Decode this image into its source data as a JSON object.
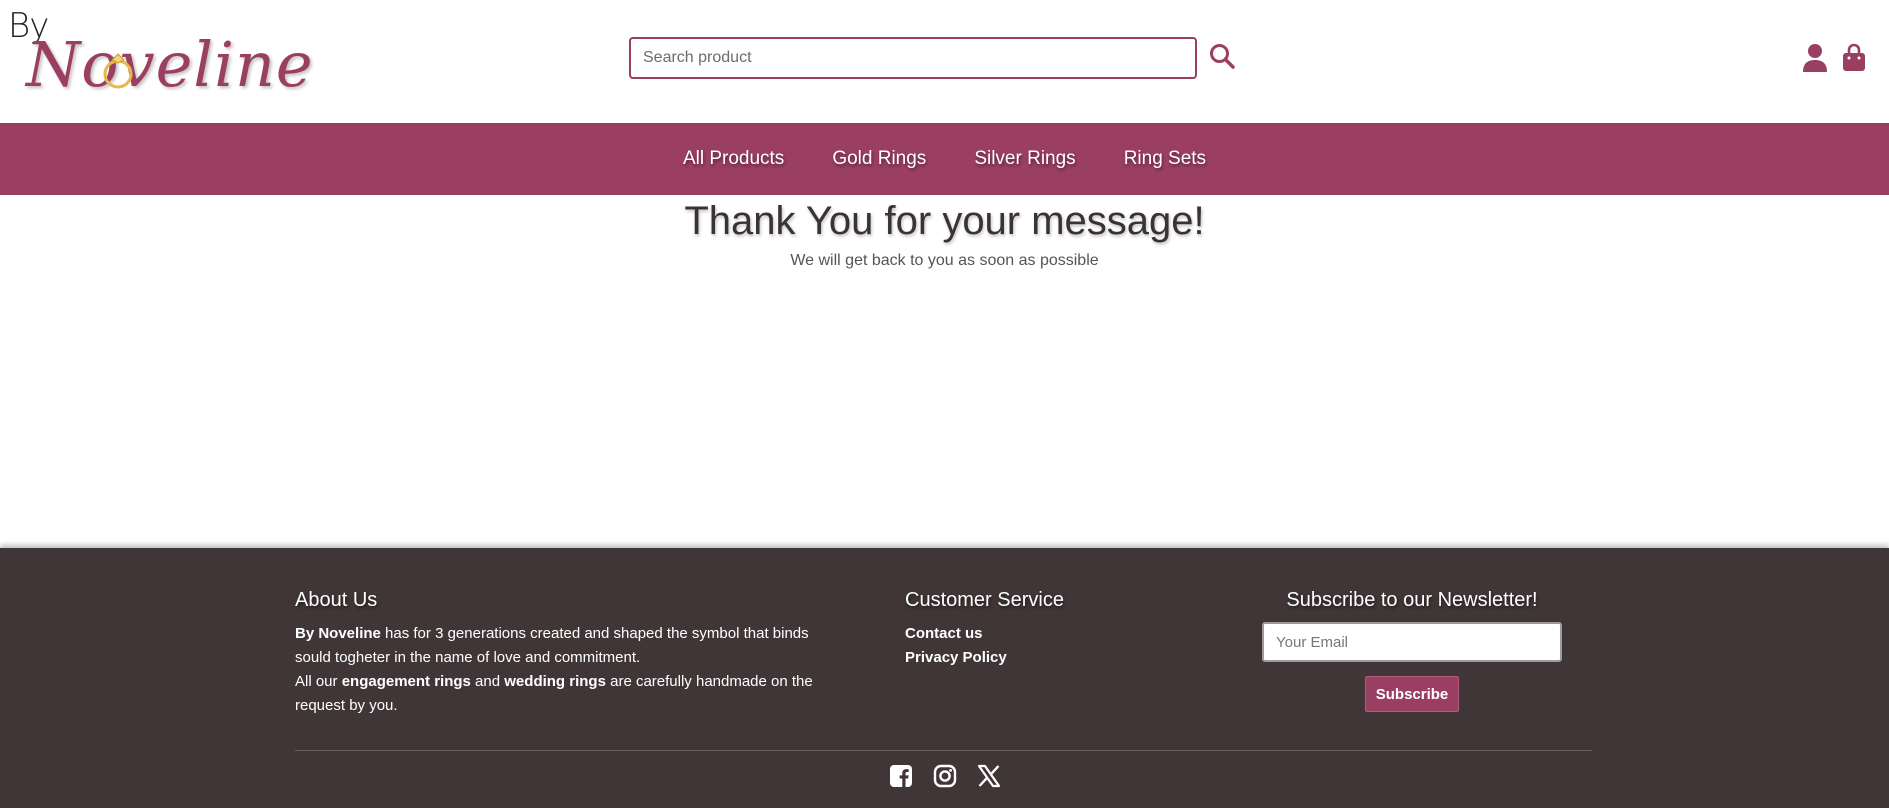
{
  "brand": {
    "by": "By",
    "name": "Noveline",
    "colors": {
      "primary": "#9b3f62",
      "footer_bg": "#403637",
      "ring_gold": "#e8b84a"
    }
  },
  "search": {
    "placeholder": "Search product",
    "value": "",
    "icon": "search-icon"
  },
  "header_actions": {
    "account_icon": "user-icon",
    "cart_icon": "shopping-bag-icon"
  },
  "nav": {
    "items": [
      {
        "label": "All Products"
      },
      {
        "label": "Gold Rings"
      },
      {
        "label": "Silver Rings"
      },
      {
        "label": "Ring Sets"
      }
    ]
  },
  "main": {
    "title": "Thank You for your message!",
    "subtitle": "We will get back to you as soon as possible"
  },
  "footer": {
    "about": {
      "heading": "About Us",
      "p1_bold": "By Noveline",
      "p1_rest": " has for 3 generations created and shaped the symbol that binds sould togheter in the name of love and commitment.",
      "p2_a": "All our ",
      "p2_bold1": "engagement rings",
      "p2_b": " and ",
      "p2_bold2": "wedding rings",
      "p2_c": " are carefully handmade on the request by you."
    },
    "service": {
      "heading": "Customer Service",
      "links": [
        {
          "label": "Contact us"
        },
        {
          "label": "Privacy Policy"
        }
      ]
    },
    "newsletter": {
      "heading": "Subscribe to our Newsletter!",
      "email_placeholder": "Your Email",
      "email_value": "",
      "button_label": "Subscribe"
    },
    "socials": [
      "facebook-icon",
      "instagram-icon",
      "x-twitter-icon"
    ]
  }
}
